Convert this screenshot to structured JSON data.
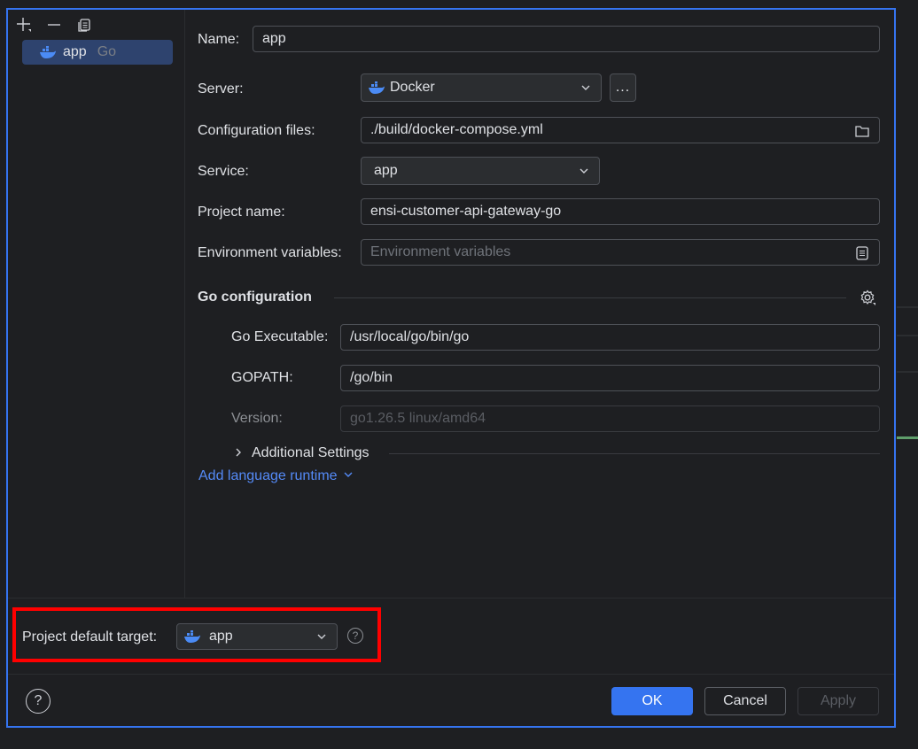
{
  "colors": {
    "accent": "#3574f0",
    "link": "#548af7",
    "highlight": "#ff0000",
    "docker": "#4b8bf5"
  },
  "toolbar": {
    "add_icon": "plus-icon",
    "remove_icon": "minus-icon",
    "copy_icon": "copy-icon"
  },
  "tree": {
    "items": [
      {
        "label": "app",
        "type": "Go",
        "icon": "docker-icon"
      }
    ]
  },
  "form": {
    "name_label": "Name:",
    "name_value": "app",
    "server_label": "Server:",
    "server_value": "Docker",
    "server_more": "...",
    "config_label": "Configuration files:",
    "config_value": "./build/docker-compose.yml",
    "service_label": "Service:",
    "service_value": "app",
    "project_label": "Project name:",
    "project_value": "ensi-customer-api-gateway-go",
    "env_label": "Environment variables:",
    "env_placeholder": "Environment variables",
    "go_section": "Go configuration",
    "go_exec_label": "Go Executable:",
    "go_exec_value": "/usr/local/go/bin/go",
    "gopath_label": "GOPATH:",
    "gopath_value": "/go/bin",
    "version_label": "Version:",
    "version_value": "go1.26.5 linux/amd64",
    "additional": "Additional Settings",
    "add_runtime": "Add language runtime"
  },
  "footer": {
    "default_target_label": "Project default target:",
    "default_target_value": "app",
    "help": "?",
    "ok": "OK",
    "cancel": "Cancel",
    "apply": "Apply"
  }
}
